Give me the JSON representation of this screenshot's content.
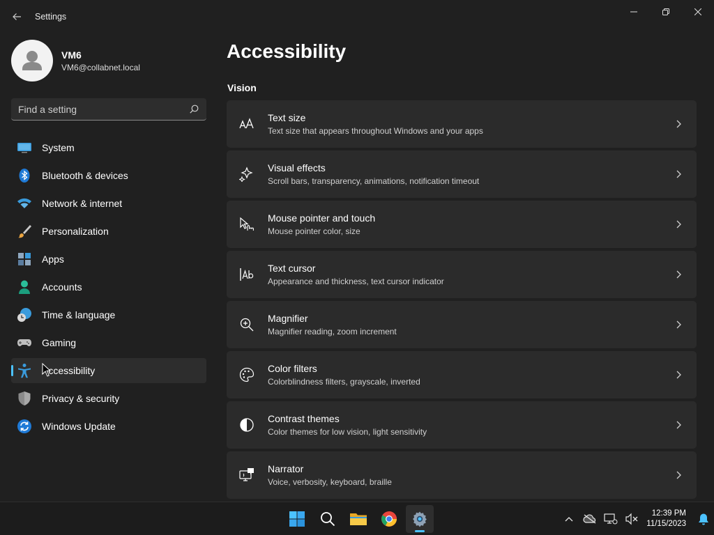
{
  "window": {
    "title": "Settings",
    "controls": [
      "minimize",
      "restore",
      "close"
    ]
  },
  "profile": {
    "name": "VM6",
    "email": "VM6@collabnet.local"
  },
  "search": {
    "placeholder": "Find a setting"
  },
  "nav": {
    "items": [
      {
        "label": "System",
        "icon": "system-icon"
      },
      {
        "label": "Bluetooth & devices",
        "icon": "bluetooth-icon"
      },
      {
        "label": "Network & internet",
        "icon": "wifi-icon"
      },
      {
        "label": "Personalization",
        "icon": "paintbrush-icon"
      },
      {
        "label": "Apps",
        "icon": "apps-icon"
      },
      {
        "label": "Accounts",
        "icon": "accounts-icon"
      },
      {
        "label": "Time & language",
        "icon": "clock-globe-icon"
      },
      {
        "label": "Gaming",
        "icon": "gamepad-icon"
      },
      {
        "label": "Accessibility",
        "icon": "accessibility-icon",
        "selected": true
      },
      {
        "label": "Privacy & security",
        "icon": "shield-icon"
      },
      {
        "label": "Windows Update",
        "icon": "update-icon"
      }
    ]
  },
  "main": {
    "title": "Accessibility",
    "section": "Vision",
    "cards": [
      {
        "title": "Text size",
        "subtitle": "Text size that appears throughout Windows and your apps",
        "icon": "text-size-icon"
      },
      {
        "title": "Visual effects",
        "subtitle": "Scroll bars, transparency, animations, notification timeout",
        "icon": "sparkle-icon"
      },
      {
        "title": "Mouse pointer and touch",
        "subtitle": "Mouse pointer color, size",
        "icon": "pointer-touch-icon"
      },
      {
        "title": "Text cursor",
        "subtitle": "Appearance and thickness, text cursor indicator",
        "icon": "text-cursor-icon"
      },
      {
        "title": "Magnifier",
        "subtitle": "Magnifier reading, zoom increment",
        "icon": "magnifier-icon"
      },
      {
        "title": "Color filters",
        "subtitle": "Colorblindness filters, grayscale, inverted",
        "icon": "palette-icon"
      },
      {
        "title": "Contrast themes",
        "subtitle": "Color themes for low vision, light sensitivity",
        "icon": "contrast-icon"
      },
      {
        "title": "Narrator",
        "subtitle": "Voice, verbosity, keyboard, braille",
        "icon": "narrator-icon"
      }
    ]
  },
  "taskbar": {
    "apps": [
      "start-icon",
      "search-icon",
      "file-explorer-icon",
      "chrome-icon",
      "settings-icon"
    ],
    "active_app": "settings-icon",
    "time": "12:39 PM",
    "date": "11/15/2023"
  },
  "colors": {
    "accent": "#4cc2ff",
    "background": "#202020",
    "card": "#2b2b2b"
  }
}
